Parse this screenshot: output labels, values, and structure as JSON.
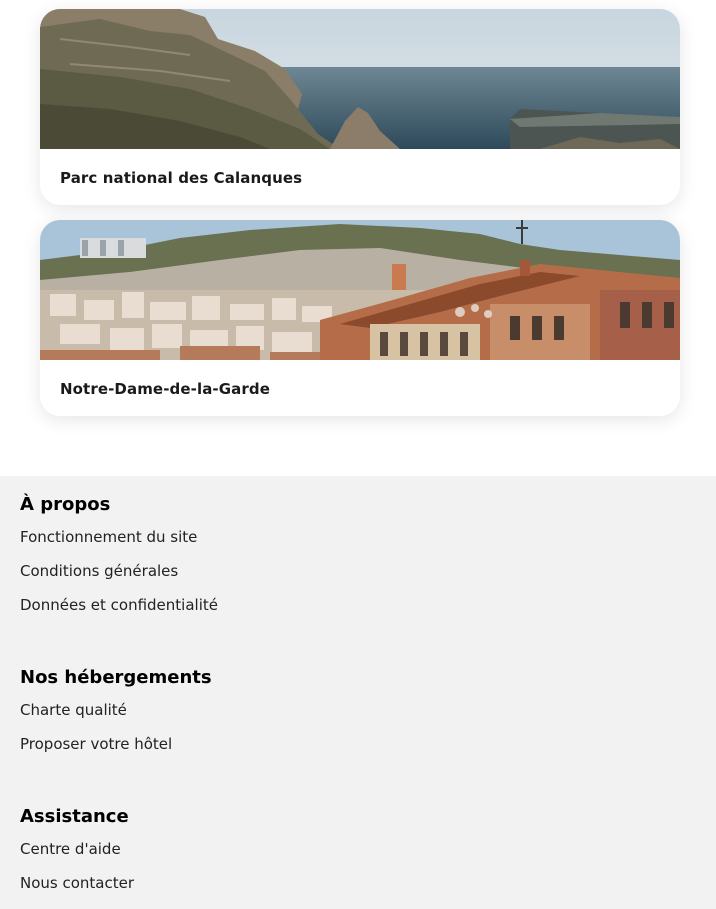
{
  "cards": [
    {
      "title": "Parc national des Calanques",
      "image": "calanques-coastal-cliffs-photo"
    },
    {
      "title": "Notre-Dame-de-la-Garde",
      "image": "marseille-city-rooftops-photo"
    }
  ],
  "footer": {
    "sections": [
      {
        "heading": "À propos",
        "links": [
          "Fonctionnement du site",
          "Conditions générales",
          "Données et confidentialité"
        ]
      },
      {
        "heading": "Nos hébergements",
        "links": [
          "Charte qualité",
          "Proposer votre hôtel"
        ]
      },
      {
        "heading": "Assistance",
        "links": [
          "Centre d'aide",
          "Nous contacter"
        ]
      }
    ]
  },
  "colors": {
    "footer_bg": "#f2f2f2",
    "card_bg": "#ffffff",
    "text": "#1a1a1a"
  }
}
